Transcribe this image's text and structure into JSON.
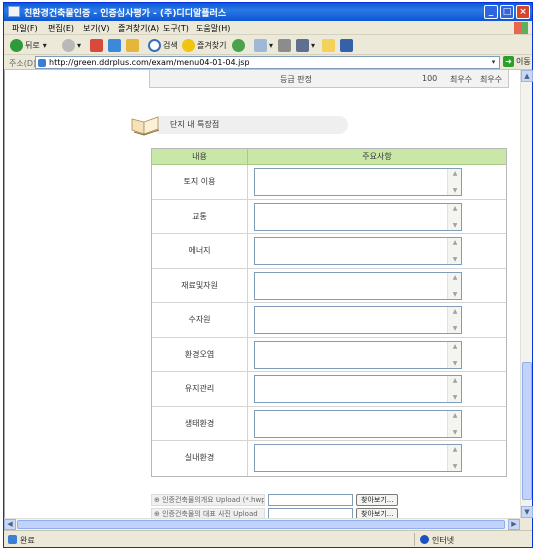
{
  "window": {
    "title": "친환경건축물인증 - 인증심사평가 - (주)디디알플러스",
    "minimize": "_",
    "maximize": "□",
    "close": "×"
  },
  "menu": [
    "파일(F)",
    "편집(E)",
    "보기(V)",
    "즐겨찾기(A)",
    "도구(T)",
    "도움말(H)"
  ],
  "toolbar": {
    "back_label": "뒤로",
    "search_label": "검색",
    "favorites_label": "즐겨찾기"
  },
  "address": {
    "label": "주소(D)",
    "url": "http://green.ddrplus.com/exam/menu04-01-04.jsp",
    "go_label": "이동"
  },
  "grade_row": {
    "label": "등급 판정",
    "score": "100",
    "grade_1": "최우수",
    "grade_2": "최우수"
  },
  "section": {
    "title": "단지 내 특장점"
  },
  "table": {
    "col_content": "내용",
    "col_notes": "주요사항",
    "rows": [
      {
        "label": "토지 이용",
        "value": ""
      },
      {
        "label": "교통",
        "value": ""
      },
      {
        "label": "에너지",
        "value": ""
      },
      {
        "label": "재료및자원",
        "value": ""
      },
      {
        "label": "수자원",
        "value": ""
      },
      {
        "label": "환경오염",
        "value": ""
      },
      {
        "label": "유지관리",
        "value": ""
      },
      {
        "label": "생태환경",
        "value": ""
      },
      {
        "label": "실내환경",
        "value": ""
      }
    ]
  },
  "uploads": [
    {
      "label": "인증건축물의개요 Upload (*.hwp)",
      "button": "찾아보기..."
    },
    {
      "label": "인증건축물의 대표 사진 Upload",
      "button": "찾아보기..."
    }
  ],
  "status": {
    "text": "완료",
    "zone": "인터넷"
  },
  "colors": {
    "table_header": "#c9e8a8",
    "titlebar": "#0a5ad9",
    "close_button": "#d9452c"
  }
}
